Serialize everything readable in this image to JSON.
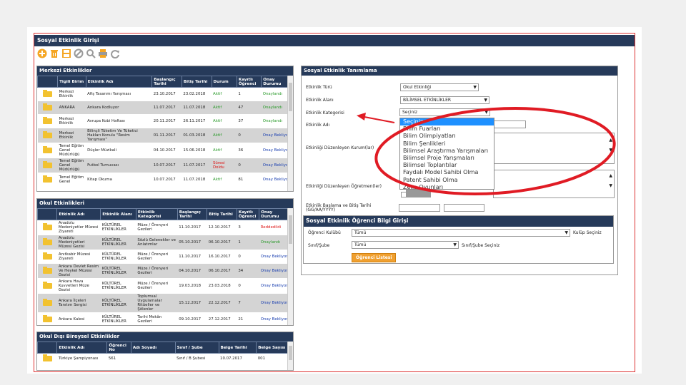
{
  "window": {
    "title": "Sosyal Etkinlik Girişi"
  },
  "toolbar": [
    "add-icon",
    "delete-icon",
    "save-icon",
    "cancel-icon",
    "search-icon",
    "print-icon",
    "refresh-icon"
  ],
  "merkezi": {
    "title": "Merkezi Etkinlikler",
    "columns": [
      "",
      "Tigili Birim",
      "Etkinlik Adı",
      "Başlangıç Tarihi",
      "Bitiş Tarihi",
      "Durum",
      "Kayıtlı Öğrenci",
      "Onay Durumu"
    ],
    "rows": [
      [
        "Merkezi Etkinlik",
        "Afiş Tasarımı Yarışması",
        "23.10.2017",
        "23.02.2018",
        "Aktif",
        "1",
        "Onaylandı"
      ],
      [
        "ANKARA",
        "Ankara Kodluyor",
        "11.07.2017",
        "11.07.2018",
        "Aktif",
        "47",
        "Onaylandı"
      ],
      [
        "Merkezi Etkinlik",
        "Avrupa Kobi Haftası",
        "20.11.2017",
        "26.11.2017",
        "Aktif",
        "37",
        "Onaylandı"
      ],
      [
        "Merkezi Etkinlik",
        "Bilinçli Tüketim Ve Tüketici Hakları Konulu \"Resim Yarışması\"",
        "01.11.2017",
        "01.03.2018",
        "Aktif",
        "0",
        "Onay Bekliyor"
      ],
      [
        "Temel Eğitim Genel Müdürlüğü",
        "Düşler Müzikali",
        "04.10.2017",
        "15.06.2018",
        "Aktif",
        "36",
        "Onay Bekliyor"
      ],
      [
        "Temel Eğitim Genel Müdürlüğü",
        "Futbol Turnuvası",
        "10.07.2017",
        "11.07.2017",
        "Süresi Doldu",
        "0",
        "Onay Bekliyor"
      ],
      [
        "Temel Eğitim Genel",
        "Kitap Okuma",
        "10.07.2017",
        "11.07.2018",
        "Aktif",
        "81",
        "Onay Bekliyor"
      ]
    ]
  },
  "okul": {
    "title": "Okul Etkinlikleri",
    "columns": [
      "",
      "Etkinlik Adı",
      "Etkinlik Alanı",
      "Etkinlik Kategorisi",
      "Başlangıç Tarihi",
      "Bitiş Tarihi",
      "Kayıtlı Öğrenci",
      "Onay Durumu"
    ],
    "rows": [
      [
        "Anadolu Medeniyetler Müzesi Ziyareti",
        "KÜLTÜREL ETKİNLİKLER",
        "Müze / Örenyeri Gezileri",
        "11.10.2017",
        "12.10.2017",
        "3",
        "Reddedildi"
      ],
      [
        "Anadolu Medeniyetleri Müzesi Gezisi",
        "KÜLTÜREL ETKİNLİKLER",
        "Sözlü Gelenekler ve Anlatımlar",
        "05.10.2017",
        "06.10.2017",
        "1",
        "Onaylandı"
      ],
      [
        "Anıtkabir Müzesi Ziyareti",
        "KÜLTÜREL ETKİNLİKLER",
        "Müze / Örenyeri Gezileri",
        "11.10.2017",
        "16.10.2017",
        "0",
        "Onay Bekliyor"
      ],
      [
        "Ankara Devlet Resim Ve Heykel Müzesi Gezisi",
        "KÜLTÜREL ETKİNLİKLER",
        "Müze / Örenyeri Gezileri",
        "04.10.2017",
        "06.10.2017",
        "34",
        "Onay Bekliyor"
      ],
      [
        "Ankara Hava Kuvvetleri Müze Gezisi",
        "KÜLTÜREL ETKİNLİKLER",
        "Müze / Örenyeri Gezileri",
        "19.03.2018",
        "23.03.2018",
        "0",
        "Onay Bekliyor"
      ],
      [
        "Ankara İlçeleri Tanıtım Sergisi",
        "KÜLTÜREL ETKİNLİKLER",
        "Toplumsal Uygulamalar Ritüeller ve Şölenler",
        "15.12.2017",
        "22.12.2017",
        "7",
        "Onay Bekliyor"
      ],
      [
        "Ankara Kalesi",
        "KÜLTÜREL ETKİNLİKLER",
        "Tarihi Mekân Gezileri",
        "09.10.2017",
        "27.12.2017",
        "21",
        "Onay Bekliyor"
      ]
    ]
  },
  "bireysel": {
    "title": "Okul Dışı Bireysel Etkinlikler",
    "columns": [
      "",
      "Etkinlik Adı",
      "Öğrenci No",
      "Adı Soyadı",
      "Sınıf / Şube",
      "Belge Tarihi",
      "Belge Sayısı"
    ],
    "rows": [
      [
        "Türkiye Şampiyonası",
        "561",
        "",
        "Sınıf / B Şubesi",
        "10.07.2017",
        "001"
      ]
    ]
  },
  "tanim": {
    "title": "Sosyal Etkinlik Tanımlama",
    "turu_label": "Etkinlik Türü",
    "turu_value": "Okul Etkinliği",
    "alani_label": "Etkinlik Alanı",
    "alani_value": "BİLİMSEL ETKİNLİKLER",
    "kategori_label": "Etkinlik Kategorisi",
    "kategori_value": "Seçiniz",
    "adi_label": "Etkinlik Adı",
    "kurum_label": "Etkinliği Düzenleyen Kurum(lar)",
    "ogretmen_label": "Etkinliği Düzenleyen Öğretmen(ler)",
    "tarih_label": "Etkinlik Başlama ve Bitiş Tarihi (GG/AA/YYYY)"
  },
  "dropdown": [
    "Seçiniz",
    "Bilim Fuarları",
    "Bilim Olimpiyatları",
    "Bilim Şenlikleri",
    "Bilimsel Araştırma Yarışmaları",
    "Bilimsel Proje Yarışmaları",
    "Bilimsel Toplantılar",
    "Faydalı Model Sahibi Olma",
    "Patent Sahibi Olma",
    "Zeka Oyunları"
  ],
  "ogrenci": {
    "title": "Sosyal Etkinlik Öğrenci Bilgi Girişi",
    "kulup_label": "Öğrenci Kulübü",
    "kulup_value": "Tümü",
    "kulup_hint": "Kulüp Seçiniz",
    "sinif_label": "Sınıf/Şube",
    "sinif_value": "Tümü",
    "sinif_hint": "Sınıf/Şube Seçiniz",
    "button": "Öğrenci Listesi"
  },
  "colors": {
    "header": "#263a5a",
    "annotation": "#e01b24",
    "highlight": "#1e90ff"
  }
}
